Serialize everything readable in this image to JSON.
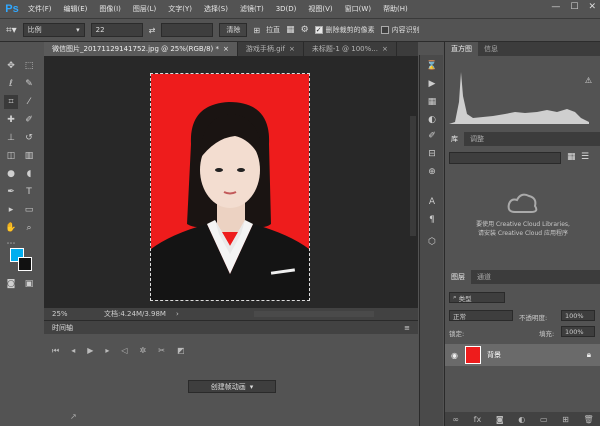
{
  "app": {
    "logo": "Ps"
  },
  "menu": [
    "文件(F)",
    "编辑(E)",
    "图像(I)",
    "图层(L)",
    "文字(Y)",
    "选择(S)",
    "滤镜(T)",
    "3D(D)",
    "视图(V)",
    "窗口(W)",
    "帮助(H)"
  ],
  "options": {
    "ratio": "比例",
    "width_value": "22",
    "clear_label": "清除",
    "straighten_label": "拉直",
    "delete_cropped_label": "删除裁剪的像素",
    "content_aware_label": "内容识别"
  },
  "tabs": [
    {
      "label": "微信图片_20171129141752.jpg @ 25%(RGB/8) *",
      "active": true
    },
    {
      "label": "游戏手柄.gif",
      "active": false
    },
    {
      "label": "未标题-1 @ 100%...",
      "active": false
    }
  ],
  "status": {
    "zoom": "25%",
    "doc": "文档:4.24M/3.98M"
  },
  "timeline": {
    "title": "时间轴",
    "create_label": "创建帧动画"
  },
  "right": {
    "histogram_tab": "直方图",
    "info_tab": "信息",
    "library_tab": "库",
    "adjust_tab": "调整",
    "cc_note_line1": "要使用 Creative Cloud Libraries,",
    "cc_note_line2": "请安装 Creative Cloud 应用程序",
    "layers_tab": "图层",
    "channels_tab": "通道",
    "kind_label": "类型",
    "blend_mode": "正常",
    "opacity_label": "不透明度:",
    "opacity_value": "100%",
    "lock_label": "锁定:",
    "fill_label": "填充:",
    "fill_value": "100%",
    "layer_name": "背景"
  },
  "colors": {
    "foreground": "#00aeef",
    "background": "#111111",
    "canvas_bg": "#ee1c1c"
  }
}
